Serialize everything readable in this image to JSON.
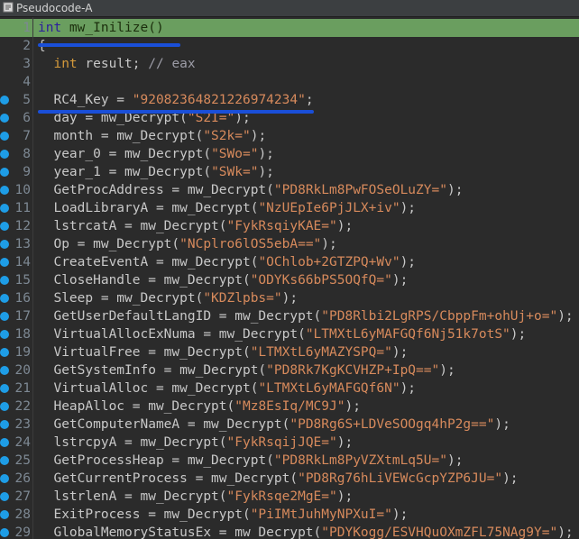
{
  "window": {
    "title": "Pseudocode-A"
  },
  "colors": {
    "keyword": "#d59a3b",
    "string": "#d78a5c",
    "highlight_row": "#6a9e5f",
    "annotation_underline": "#1a4fd8",
    "breakpoint_dot": "#1e9de6"
  },
  "lines": [
    {
      "n": "1",
      "parts": [
        [
          "kw",
          "int"
        ],
        [
          "t",
          " mw_Inilize()"
        ]
      ],
      "hl": true,
      "dot": false
    },
    {
      "n": "2",
      "parts": [
        [
          "t",
          "{"
        ]
      ],
      "hl": false,
      "dot": false
    },
    {
      "n": "3",
      "parts": [
        [
          "t",
          "  "
        ],
        [
          "kw",
          "int"
        ],
        [
          "t",
          " result; "
        ],
        [
          "cm",
          "// eax"
        ]
      ],
      "hl": false,
      "dot": false
    },
    {
      "n": "4",
      "parts": [
        [
          "t",
          ""
        ]
      ],
      "hl": false,
      "dot": false
    },
    {
      "n": "5",
      "parts": [
        [
          "t",
          "  RC4_Key = "
        ],
        [
          "str",
          "\"92082364821226974234\""
        ],
        [
          "t",
          ";"
        ]
      ],
      "hl": false,
      "dot": true
    },
    {
      "n": "6",
      "parts": [
        [
          "t",
          "  day = mw_Decrypt("
        ],
        [
          "str",
          "\"S2I=\""
        ],
        [
          "t",
          ");"
        ]
      ],
      "hl": false,
      "dot": true
    },
    {
      "n": "7",
      "parts": [
        [
          "t",
          "  month = mw_Decrypt("
        ],
        [
          "str",
          "\"S2k=\""
        ],
        [
          "t",
          ");"
        ]
      ],
      "hl": false,
      "dot": true
    },
    {
      "n": "8",
      "parts": [
        [
          "t",
          "  year_0 = mw_Decrypt("
        ],
        [
          "str",
          "\"SWo=\""
        ],
        [
          "t",
          ");"
        ]
      ],
      "hl": false,
      "dot": true
    },
    {
      "n": "9",
      "parts": [
        [
          "t",
          "  year_1 = mw_Decrypt("
        ],
        [
          "str",
          "\"SWk=\""
        ],
        [
          "t",
          ");"
        ]
      ],
      "hl": false,
      "dot": true
    },
    {
      "n": "10",
      "parts": [
        [
          "t",
          "  GetProcAddress = mw_Decrypt("
        ],
        [
          "str",
          "\"PD8RkLm8PwFOSeOLuZY=\""
        ],
        [
          "t",
          ");"
        ]
      ],
      "hl": false,
      "dot": true
    },
    {
      "n": "11",
      "parts": [
        [
          "t",
          "  LoadLibraryA = mw_Decrypt("
        ],
        [
          "str",
          "\"NzUEpIe6PjJLX+iv\""
        ],
        [
          "t",
          ");"
        ]
      ],
      "hl": false,
      "dot": true
    },
    {
      "n": "12",
      "parts": [
        [
          "t",
          "  lstrcatA = mw_Decrypt("
        ],
        [
          "str",
          "\"FykRsqiyKAE=\""
        ],
        [
          "t",
          ");"
        ]
      ],
      "hl": false,
      "dot": true
    },
    {
      "n": "13",
      "parts": [
        [
          "t",
          "  Op = mw_Decrypt("
        ],
        [
          "str",
          "\"NCplro6lOS5ebA==\""
        ],
        [
          "t",
          ");"
        ]
      ],
      "hl": false,
      "dot": true
    },
    {
      "n": "14",
      "parts": [
        [
          "t",
          "  CreateEventA = mw_Decrypt("
        ],
        [
          "str",
          "\"OChlob+2GTZPQ+Wv\""
        ],
        [
          "t",
          ");"
        ]
      ],
      "hl": false,
      "dot": true
    },
    {
      "n": "15",
      "parts": [
        [
          "t",
          "  CloseHandle = mw_Decrypt("
        ],
        [
          "str",
          "\"ODYKs66bPS5OQfQ=\""
        ],
        [
          "t",
          ");"
        ]
      ],
      "hl": false,
      "dot": true
    },
    {
      "n": "16",
      "parts": [
        [
          "t",
          "  Sleep = mw_Decrypt("
        ],
        [
          "str",
          "\"KDZlpbs=\""
        ],
        [
          "t",
          ");"
        ]
      ],
      "hl": false,
      "dot": true
    },
    {
      "n": "17",
      "parts": [
        [
          "t",
          "  GetUserDefaultLangID = mw_Decrypt("
        ],
        [
          "str",
          "\"PD8Rlbi2LgRPS/CbppFm+ohUj+o=\""
        ],
        [
          "t",
          ");"
        ]
      ],
      "hl": false,
      "dot": true
    },
    {
      "n": "18",
      "parts": [
        [
          "t",
          "  VirtualAllocExNuma = mw_Decrypt("
        ],
        [
          "str",
          "\"LTMXtL6yMAFGQf6Nj51k7otS\""
        ],
        [
          "t",
          ");"
        ]
      ],
      "hl": false,
      "dot": true
    },
    {
      "n": "19",
      "parts": [
        [
          "t",
          "  VirtualFree = mw_Decrypt("
        ],
        [
          "str",
          "\"LTMXtL6yMAZYSPQ=\""
        ],
        [
          "t",
          ");"
        ]
      ],
      "hl": false,
      "dot": true
    },
    {
      "n": "20",
      "parts": [
        [
          "t",
          "  GetSystemInfo = mw_Decrypt("
        ],
        [
          "str",
          "\"PD8Rk7KgKCVHZP+IpQ==\""
        ],
        [
          "t",
          ");"
        ]
      ],
      "hl": false,
      "dot": true
    },
    {
      "n": "21",
      "parts": [
        [
          "t",
          "  VirtualAlloc = mw_Decrypt("
        ],
        [
          "str",
          "\"LTMXtL6yMAFGQf6N\""
        ],
        [
          "t",
          ");"
        ]
      ],
      "hl": false,
      "dot": true
    },
    {
      "n": "22",
      "parts": [
        [
          "t",
          "  HeapAlloc = mw_Decrypt("
        ],
        [
          "str",
          "\"Mz8EsIq/MC9J\""
        ],
        [
          "t",
          ");"
        ]
      ],
      "hl": false,
      "dot": true
    },
    {
      "n": "23",
      "parts": [
        [
          "t",
          "  GetComputerNameA = mw_Decrypt("
        ],
        [
          "str",
          "\"PD8Rg6S+LDVeSOOgq4hP2g==\""
        ],
        [
          "t",
          ");"
        ]
      ],
      "hl": false,
      "dot": true
    },
    {
      "n": "24",
      "parts": [
        [
          "t",
          "  lstrcpyA = mw_Decrypt("
        ],
        [
          "str",
          "\"FykRsqijJQE=\""
        ],
        [
          "t",
          ");"
        ]
      ],
      "hl": false,
      "dot": true
    },
    {
      "n": "25",
      "parts": [
        [
          "t",
          "  GetProcessHeap = mw_Decrypt("
        ],
        [
          "str",
          "\"PD8RkLm8PyVZXtmLq5U=\""
        ],
        [
          "t",
          ");"
        ]
      ],
      "hl": false,
      "dot": true
    },
    {
      "n": "26",
      "parts": [
        [
          "t",
          "  GetCurrentProcess = mw_Decrypt("
        ],
        [
          "str",
          "\"PD8Rg76hLiVEWcGcpYZP6JU=\""
        ],
        [
          "t",
          ");"
        ]
      ],
      "hl": false,
      "dot": true
    },
    {
      "n": "27",
      "parts": [
        [
          "t",
          "  lstrlenA = mw_Decrypt("
        ],
        [
          "str",
          "\"FykRsqe2MgE=\""
        ],
        [
          "t",
          ");"
        ]
      ],
      "hl": false,
      "dot": true
    },
    {
      "n": "28",
      "parts": [
        [
          "t",
          "  ExitProcess = mw_Decrypt("
        ],
        [
          "str",
          "\"PiIMtJuhMyNPXuI=\""
        ],
        [
          "t",
          ");"
        ]
      ],
      "hl": false,
      "dot": true
    },
    {
      "n": "29",
      "parts": [
        [
          "t",
          "  GlobalMemoryStatusEx = mw_Decrypt("
        ],
        [
          "str",
          "\"PDYKogg/ESVHQuOXmZFL75NAg9Y=\""
        ],
        [
          "t",
          ");"
        ]
      ],
      "hl": false,
      "dot": true
    }
  ]
}
